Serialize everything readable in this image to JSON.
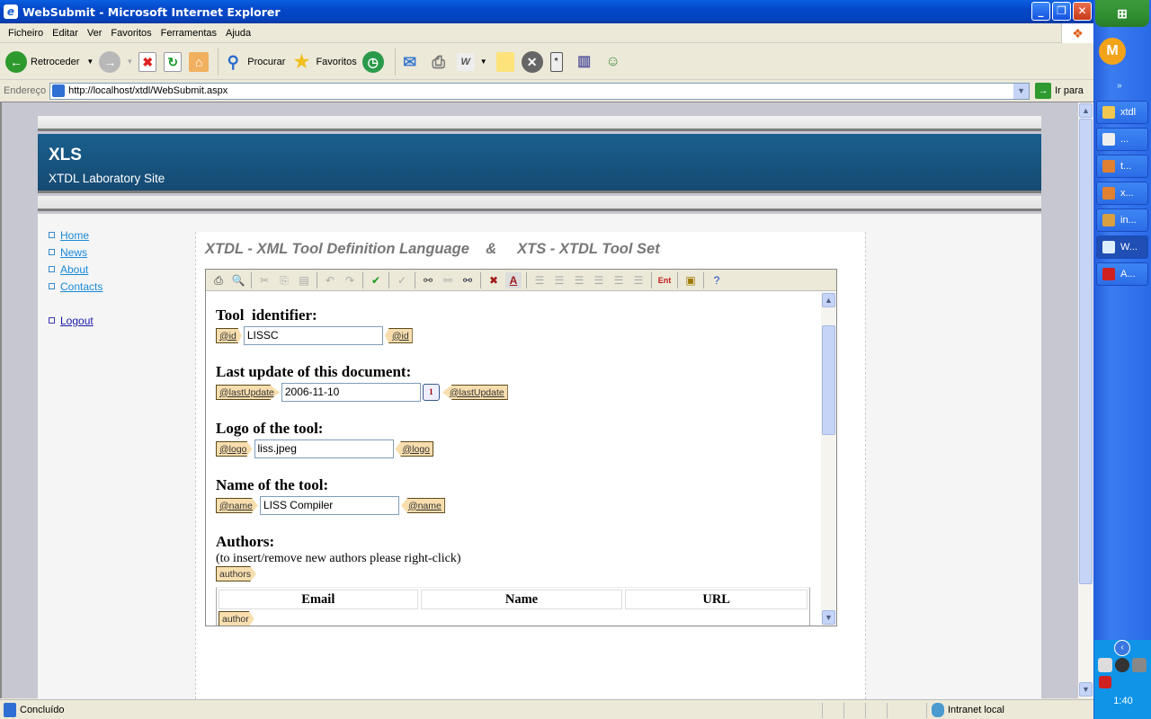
{
  "window": {
    "title": "WebSubmit - Microsoft Internet Explorer",
    "min": "_",
    "max": "❐",
    "close": "✕"
  },
  "menu": [
    "Ficheiro",
    "Editar",
    "Ver",
    "Favoritos",
    "Ferramentas",
    "Ajuda"
  ],
  "toolbar": {
    "back_label": "Retroceder",
    "search_label": "Procurar",
    "favorites_label": "Favoritos"
  },
  "address": {
    "label": "Endereço",
    "url": "http://localhost/xtdl/WebSubmit.aspx",
    "go_label": "Ir para"
  },
  "site": {
    "title": "XLS",
    "subtitle": "XTDL Laboratory Site",
    "nav": [
      "Home",
      "News",
      "About",
      "Contacts"
    ],
    "logout": "Logout",
    "heading": "XTDL - XML Tool Definition Language    &     XTS - XTDL Tool Set"
  },
  "form": {
    "tool_id": {
      "label": "Tool  identifier:",
      "tag": "@id",
      "value": "LISSC"
    },
    "last_update": {
      "label": "Last update of this document:",
      "tag": "@lastUpdate",
      "value": "2006-11-10",
      "cal": "1"
    },
    "logo": {
      "label": "Logo of the tool:",
      "tag": "@logo",
      "value": "liss.jpeg"
    },
    "name": {
      "label": "Name of the tool:",
      "tag": "@name",
      "value": "LISS Compiler"
    },
    "authors": {
      "label": "Authors:",
      "note": "(to insert/remove new authors please right-click)",
      "tag": "authors",
      "row_tag": "author",
      "columns": [
        "Email",
        "Name",
        "URL"
      ]
    }
  },
  "status": {
    "text": "Concluído",
    "zone": "Intranet local"
  },
  "taskbar": {
    "start": "⊞",
    "items": [
      "xtdl",
      "...",
      "t...",
      "x...",
      "in...",
      "W...",
      "A..."
    ],
    "clock": "1:40"
  }
}
